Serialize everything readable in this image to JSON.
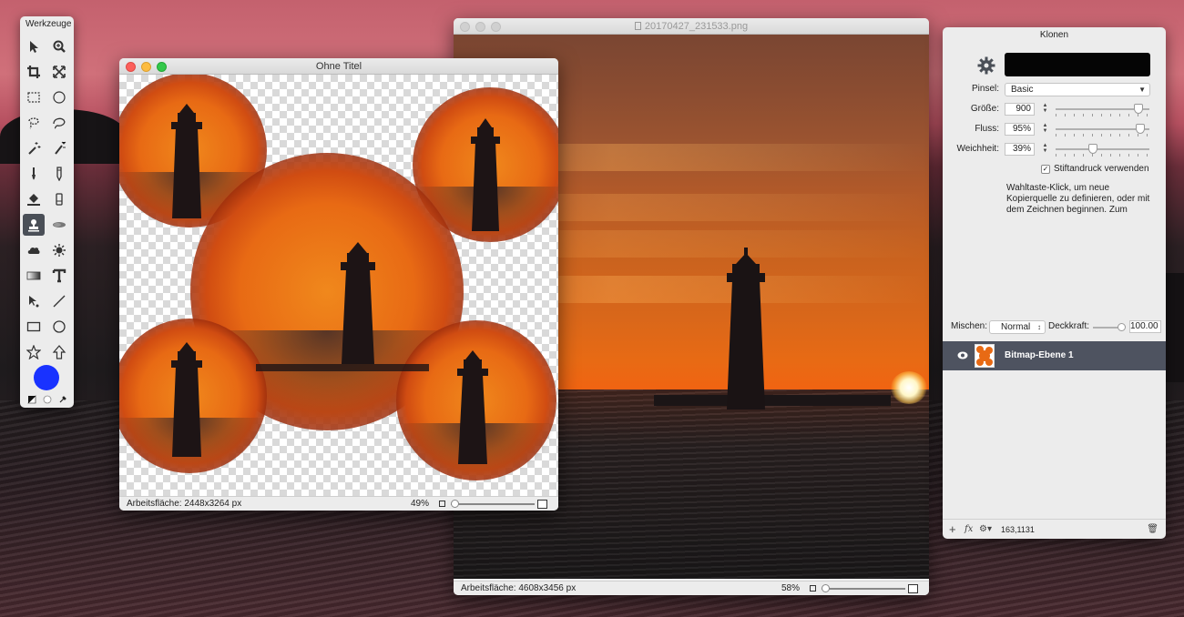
{
  "tools_panel": {
    "title": "Werkzeuge",
    "tools": [
      {
        "name": "pointer-tool",
        "icon": "arrow-icon"
      },
      {
        "name": "zoom-tool",
        "icon": "magnifier-icon"
      },
      {
        "name": "crop-tool",
        "icon": "crop-icon"
      },
      {
        "name": "transform-tool",
        "icon": "resize-icon"
      },
      {
        "name": "rect-select-tool",
        "icon": "rect-marquee-icon"
      },
      {
        "name": "ellipse-select-tool",
        "icon": "ellipse-marquee-icon"
      },
      {
        "name": "lasso-tool",
        "icon": "lasso-icon"
      },
      {
        "name": "poly-lasso-tool",
        "icon": "poly-lasso-icon"
      },
      {
        "name": "magic-wand-tool",
        "icon": "magic-wand-icon"
      },
      {
        "name": "quick-select-tool",
        "icon": "quick-select-icon"
      },
      {
        "name": "brush-tool",
        "icon": "brush-icon"
      },
      {
        "name": "pencil-tool",
        "icon": "pencil-icon"
      },
      {
        "name": "fill-tool",
        "icon": "bucket-icon"
      },
      {
        "name": "eraser-tool",
        "icon": "eraser-icon"
      },
      {
        "name": "clone-tool",
        "icon": "stamp-icon"
      },
      {
        "name": "smudge-tool",
        "icon": "smudge-icon"
      },
      {
        "name": "cloud-tool",
        "icon": "cloud-icon"
      },
      {
        "name": "sun-tool",
        "icon": "sun-icon"
      },
      {
        "name": "gradient-tool",
        "icon": "gradient-icon"
      },
      {
        "name": "text-tool",
        "icon": "text-icon"
      },
      {
        "name": "path-select-tool",
        "icon": "path-select-icon"
      },
      {
        "name": "line-tool",
        "icon": "line-icon"
      },
      {
        "name": "rectangle-tool",
        "icon": "rectangle-icon"
      },
      {
        "name": "ellipse-tool",
        "icon": "ellipse-icon"
      },
      {
        "name": "star-tool",
        "icon": "star-icon"
      },
      {
        "name": "arrow-shape-tool",
        "icon": "up-arrow-icon"
      }
    ],
    "active_tool": "clone-tool",
    "color": "#1932ff"
  },
  "untitled_window": {
    "title": "Ohne Titel",
    "status_left": "Arbeitsfläche: 2448x3264 px",
    "zoom": "49%"
  },
  "photo_window": {
    "title": "20170427_231533.png",
    "status_left": "Arbeitsfläche: 4608x3456 px",
    "zoom": "58%"
  },
  "inspector": {
    "title": "Klonen",
    "brush_label": "Pinsel:",
    "brush_value": "Basic",
    "size_label": "Größe:",
    "size_value": "900",
    "size_level": 0.92,
    "flow_label": "Fluss:",
    "flow_value": "95%",
    "flow_level": 0.95,
    "softness_label": "Weichheit:",
    "softness_value": "39%",
    "softness_level": 0.39,
    "pressure_label": "Stiftandruck verwenden",
    "pressure_checked": true,
    "hint": "Wahltaste-Klick, um neue Kopierquelle zu definieren, oder mit dem Zeichnen beginnen. Zum",
    "blend_label": "Mischen:",
    "blend_value": "Normal",
    "opacity_label": "Deckkraft:",
    "opacity_value": "100.00",
    "layer_name": "Bitmap-Ebene 1",
    "coords": "163,1131"
  },
  "colors": {
    "accent_blue": "#1932ff",
    "layer_selected": "#4e5360"
  }
}
